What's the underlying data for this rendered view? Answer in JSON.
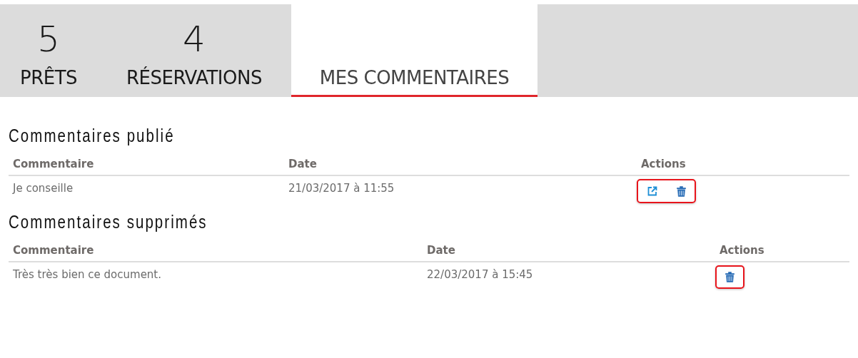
{
  "tabs": [
    {
      "count": "5",
      "label": "PRÊTS",
      "selected": false
    },
    {
      "count": "4",
      "label": "RÉSERVATIONS",
      "selected": false
    },
    {
      "label": "MES COMMENTAIRES",
      "selected": true
    }
  ],
  "sections": [
    {
      "title": "Commentaires publié",
      "columns": [
        "Commentaire",
        "Date",
        "Actions"
      ],
      "rows": [
        {
          "comment": "Je conseille",
          "date": "21/03/2017 à 11:55",
          "actions": [
            {
              "kind": "open"
            },
            {
              "kind": "delete"
            }
          ],
          "highlighted": true
        }
      ]
    },
    {
      "title": "Commentaires supprimés",
      "columns": [
        "Commentaire",
        "Date",
        "Actions"
      ],
      "rows": [
        {
          "comment": "Très très bien ce document.",
          "date": "22/03/2017 à 15:45",
          "actions": [
            {
              "kind": "delete"
            }
          ],
          "highlighted": true
        }
      ]
    }
  ]
}
